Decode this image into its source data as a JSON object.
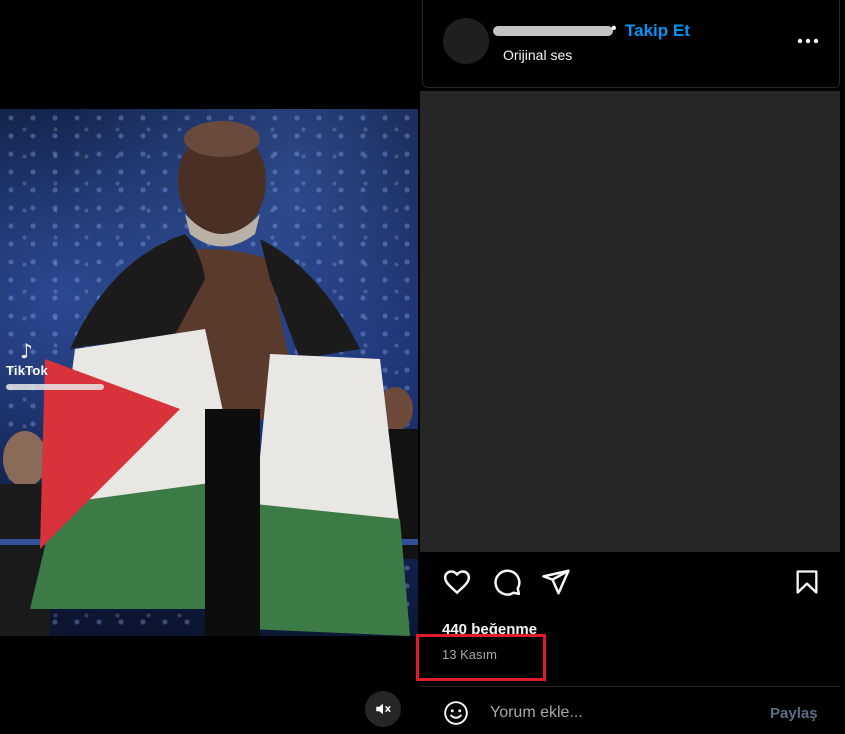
{
  "video": {
    "watermark_brand": "TikTok",
    "mute_icon": "speaker-muted-icon"
  },
  "post": {
    "follow_label": "Takip Et",
    "audio_label": "Orijinal ses",
    "more_icon": "more-horizontal-icon",
    "likes_text": "440 beğenme",
    "date_text": "13 Kasım",
    "highlight_color": "#e11b2a"
  },
  "actions": {
    "like_icon": "heart-icon",
    "comment_icon": "comment-bubble-icon",
    "share_icon": "paper-plane-icon",
    "save_icon": "bookmark-icon"
  },
  "comment_box": {
    "placeholder": "Yorum ekle...",
    "post_label": "Paylaş",
    "emoji_icon": "smiley-icon"
  },
  "colors": {
    "background": "#000000",
    "panel_gray": "#262626",
    "link_blue": "#0095f6",
    "muted_text": "#a8a8a8"
  }
}
